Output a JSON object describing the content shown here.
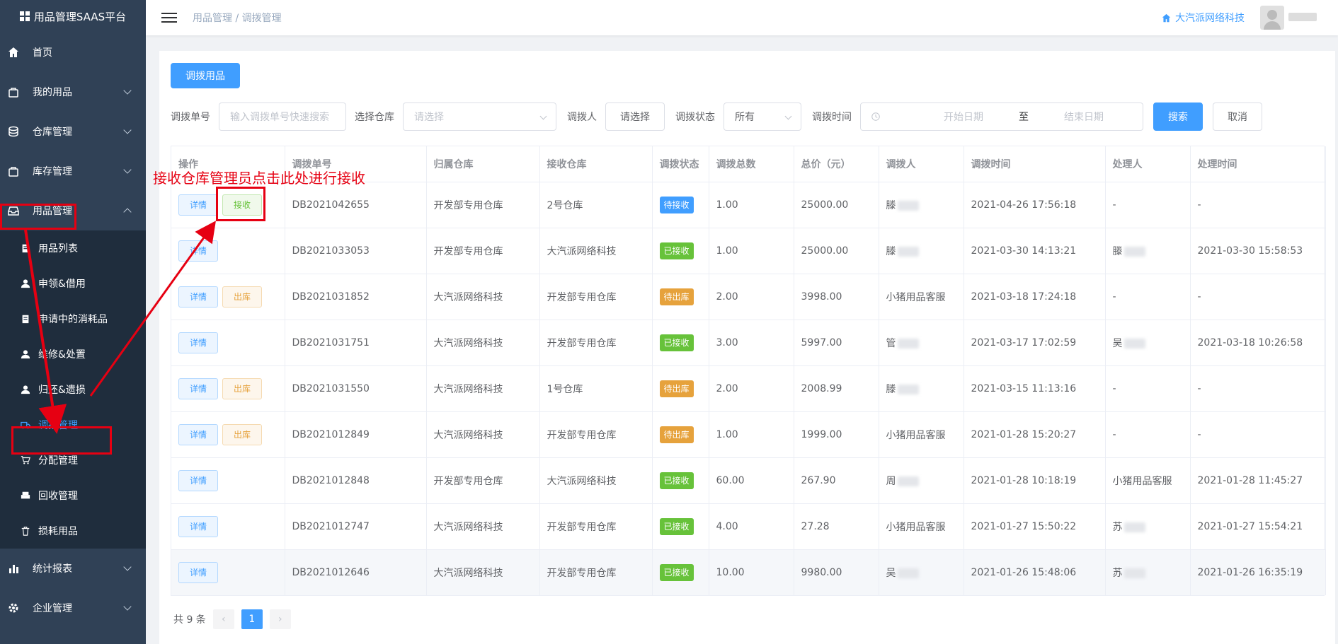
{
  "app": {
    "title": "用品管理SAAS平台"
  },
  "sidebar": {
    "items": [
      {
        "label": "首页",
        "icon": "home-icon"
      },
      {
        "label": "我的用品",
        "icon": "bag-icon"
      },
      {
        "label": "仓库管理",
        "icon": "database-icon"
      },
      {
        "label": "库存管理",
        "icon": "bag-icon"
      },
      {
        "label": "用品管理",
        "icon": "inbox-icon"
      }
    ],
    "subitems": [
      {
        "label": "用品列表",
        "icon": "clipboard-icon"
      },
      {
        "label": "申领&借用",
        "icon": "user-icon"
      },
      {
        "label": "申请中的消耗品",
        "icon": "clipboard-icon"
      },
      {
        "label": "维修&处置",
        "icon": "user-icon"
      },
      {
        "label": "归还&遗损",
        "icon": "user-icon"
      },
      {
        "label": "调拨管理",
        "icon": "truck-icon"
      },
      {
        "label": "分配管理",
        "icon": "cart-icon"
      },
      {
        "label": "回收管理",
        "icon": "printer-icon"
      },
      {
        "label": "损耗用品",
        "icon": "trash-icon"
      }
    ],
    "bottom": [
      {
        "label": "统计报表",
        "icon": "chart-icon"
      },
      {
        "label": "企业管理",
        "icon": "gear-icon"
      }
    ]
  },
  "header": {
    "breadcrumb_parent": "用品管理",
    "breadcrumb_sep": "/",
    "breadcrumb_current": "调拨管理",
    "company": "大汽派网络科技"
  },
  "toolbar": {
    "add_label": "调拨用品"
  },
  "filters": {
    "order_label": "调拨单号",
    "order_placeholder": "输入调拨单号快速搜索",
    "warehouse_label": "选择仓库",
    "warehouse_placeholder": "请选择",
    "person_label": "调拨人",
    "person_button": "请选择",
    "status_label": "调拨状态",
    "status_value": "所有",
    "time_label": "调拨时间",
    "start_placeholder": "开始日期",
    "to": "至",
    "end_placeholder": "结束日期",
    "search": "搜索",
    "cancel": "取消"
  },
  "table": {
    "headers": [
      "操作",
      "调拨单号",
      "归属仓库",
      "接收仓库",
      "调拨状态",
      "调拨总数",
      "总价（元）",
      "调拨人",
      "调拨时间",
      "处理人",
      "处理时间"
    ],
    "action_labels": {
      "detail": "详情",
      "receive": "接收",
      "out": "出库"
    },
    "rows": [
      {
        "action": "receive",
        "order": "DB2021042655",
        "owner": "开发部专用仓库",
        "receiver": "2号仓库",
        "status": "待接收",
        "status_color": "#409eff",
        "qty": "1.00",
        "price": "25000.00",
        "person": "滕",
        "time": "2021-04-26 17:56:18",
        "handler": "-",
        "handled": "-"
      },
      {
        "action": "",
        "order": "DB2021033053",
        "owner": "开发部专用仓库",
        "receiver": "大汽派网络科技",
        "status": "已接收",
        "status_color": "#67c23a",
        "qty": "1.00",
        "price": "25000.00",
        "person": "滕",
        "time": "2021-03-30 14:13:21",
        "handler": "滕",
        "handled": "2021-03-30 15:58:53"
      },
      {
        "action": "out",
        "order": "DB2021031852",
        "owner": "大汽派网络科技",
        "receiver": "开发部专用仓库",
        "status": "待出库",
        "status_color": "#e6a23c",
        "qty": "2.00",
        "price": "3998.00",
        "person": "小猪用品客服",
        "time": "2021-03-18 17:24:18",
        "handler": "-",
        "handled": "-"
      },
      {
        "action": "",
        "order": "DB2021031751",
        "owner": "大汽派网络科技",
        "receiver": "开发部专用仓库",
        "status": "已接收",
        "status_color": "#67c23a",
        "qty": "3.00",
        "price": "5997.00",
        "person": "管",
        "time": "2021-03-17 17:02:59",
        "handler": "吴",
        "handled": "2021-03-18 10:26:58"
      },
      {
        "action": "out",
        "order": "DB2021031550",
        "owner": "大汽派网络科技",
        "receiver": "1号仓库",
        "status": "待出库",
        "status_color": "#e6a23c",
        "qty": "2.00",
        "price": "2008.99",
        "person": "滕",
        "time": "2021-03-15 11:13:16",
        "handler": "-",
        "handled": "-"
      },
      {
        "action": "out",
        "order": "DB2021012849",
        "owner": "大汽派网络科技",
        "receiver": "开发部专用仓库",
        "status": "待出库",
        "status_color": "#e6a23c",
        "qty": "1.00",
        "price": "1999.00",
        "person": "小猪用品客服",
        "time": "2021-01-28 15:20:27",
        "handler": "-",
        "handled": "-"
      },
      {
        "action": "",
        "order": "DB2021012848",
        "owner": "开发部专用仓库",
        "receiver": "大汽派网络科技",
        "status": "已接收",
        "status_color": "#67c23a",
        "qty": "60.00",
        "price": "267.90",
        "person": "周",
        "time": "2021-01-28 10:18:19",
        "handler": "小猪用品客服",
        "handled": "2021-01-28 11:45:27"
      },
      {
        "action": "",
        "order": "DB2021012747",
        "owner": "大汽派网络科技",
        "receiver": "开发部专用仓库",
        "status": "已接收",
        "status_color": "#67c23a",
        "qty": "4.00",
        "price": "27.28",
        "person": "小猪用品客服",
        "time": "2021-01-27 15:50:22",
        "handler": "苏",
        "handled": "2021-01-27 15:54:21"
      },
      {
        "action": "",
        "order": "DB2021012646",
        "owner": "大汽派网络科技",
        "receiver": "开发部专用仓库",
        "status": "已接收",
        "status_color": "#67c23a",
        "qty": "10.00",
        "price": "9980.00",
        "person": "吴",
        "time": "2021-01-26 15:48:06",
        "handler": "苏",
        "handled": "2021-01-26 16:35:19"
      }
    ]
  },
  "pagination": {
    "total": "共 9 条",
    "current": "1",
    "prev": "‹",
    "next": "›"
  },
  "annotation": {
    "text": "接收仓库管理员点击此处进行接收",
    "color": "#e60012"
  }
}
